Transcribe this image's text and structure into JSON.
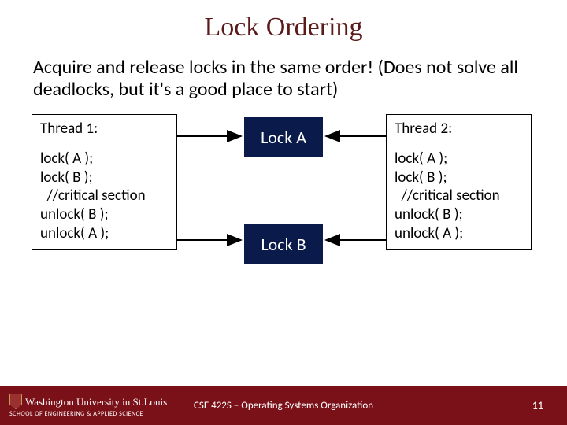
{
  "title": "Lock Ordering",
  "body": "Acquire and release locks in the same order! (Does not solve all deadlocks, but it's a good place to start)",
  "thread1": {
    "header": "Thread 1:",
    "code": [
      "lock( A );",
      "lock( B );",
      "  //critical section",
      "unlock( B );",
      "unlock( A );"
    ]
  },
  "thread2": {
    "header": "Thread 2:",
    "code": [
      "lock( A );",
      "lock( B );",
      "  //critical section",
      "unlock( B );",
      "unlock( A );"
    ]
  },
  "locks": {
    "a": "Lock A",
    "b": "Lock B"
  },
  "footer": {
    "institution": "Washington University in St.Louis",
    "school": "SCHOOL OF ENGINEERING & APPLIED SCIENCE",
    "course": "CSE 422S – Operating Systems Organization",
    "page": "11"
  }
}
